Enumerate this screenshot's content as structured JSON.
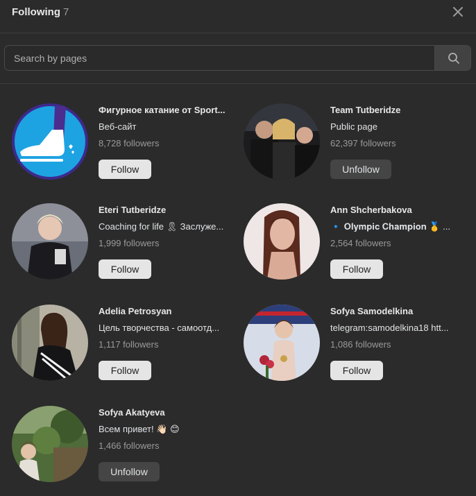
{
  "header": {
    "title": "Following",
    "count": "7",
    "close_icon": "close-icon"
  },
  "search": {
    "placeholder": "Search by pages",
    "value": "",
    "icon": "search-icon"
  },
  "pages": [
    {
      "name": "Фигурное катание от Sport...",
      "description": "Веб-сайт",
      "followers": "8,728 followers",
      "button": "Follow"
    },
    {
      "name": "Team Tutberidze",
      "description": "Public page",
      "followers": "62,397 followers",
      "button": "Unfollow"
    },
    {
      "name": "Eteri Tutberidze",
      "description": "Coaching for life 🎗 Заслуже...",
      "followers": "1,999 followers",
      "button": "Follow"
    },
    {
      "name": "Ann Shcherbakova",
      "description": "🔹 𝐎𝐥𝐲𝐦𝐩𝐢𝐜 𝐂𝐡𝐚𝐦𝐩𝐢𝐨𝐧 🥇 ...",
      "followers": "2,564 followers",
      "button": "Follow"
    },
    {
      "name": "Adelia Petrosyan",
      "description": "Цель творчества - самоотд...",
      "followers": "1,117 followers",
      "button": "Follow"
    },
    {
      "name": "Sofya Samodelkina",
      "description": "telegram:samodelkina18 htt...",
      "followers": "1,086 followers",
      "button": "Follow"
    },
    {
      "name": "Sofya Akatyeva",
      "description": "Всем привет! 👋🏻 😊",
      "followers": "1,466 followers",
      "button": "Unfollow"
    }
  ],
  "colors": {
    "background": "#2b2b2b",
    "follow_button": "#e5e5e5",
    "unfollow_button": "#454545",
    "muted_text": "#9a9a9a"
  }
}
